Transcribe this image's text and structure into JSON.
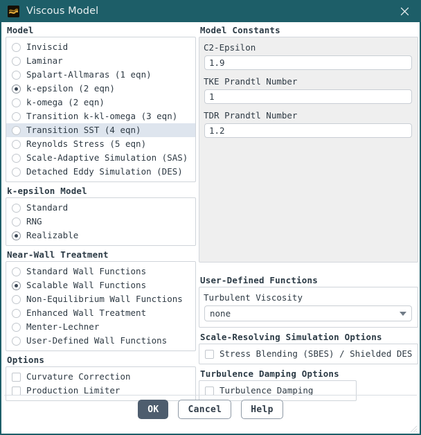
{
  "window": {
    "title": "Viscous Model",
    "icon": "fluent-wave-icon",
    "close_icon": "close-icon",
    "titlebar_color": "#1d5e68",
    "accent_color": "#4e5d6e",
    "highlight_color": "#dee5ee"
  },
  "model_group": {
    "title": "Model",
    "options": [
      {
        "label": "Inviscid",
        "selected": false,
        "highlighted": false
      },
      {
        "label": "Laminar",
        "selected": false,
        "highlighted": false
      },
      {
        "label": "Spalart-Allmaras (1 eqn)",
        "selected": false,
        "highlighted": false
      },
      {
        "label": "k-epsilon (2 eqn)",
        "selected": true,
        "highlighted": false
      },
      {
        "label": "k-omega (2 eqn)",
        "selected": false,
        "highlighted": false
      },
      {
        "label": "Transition k-kl-omega (3 eqn)",
        "selected": false,
        "highlighted": false
      },
      {
        "label": "Transition SST (4 eqn)",
        "selected": false,
        "highlighted": true
      },
      {
        "label": "Reynolds Stress (5 eqn)",
        "selected": false,
        "highlighted": false
      },
      {
        "label": "Scale-Adaptive Simulation (SAS)",
        "selected": false,
        "highlighted": false
      },
      {
        "label": "Detached Eddy Simulation (DES)",
        "selected": false,
        "highlighted": false
      }
    ]
  },
  "kepsilon_group": {
    "title": "k-epsilon Model",
    "options": [
      {
        "label": "Standard",
        "selected": false
      },
      {
        "label": "RNG",
        "selected": false
      },
      {
        "label": "Realizable",
        "selected": true
      }
    ]
  },
  "nearwall_group": {
    "title": "Near-Wall Treatment",
    "options": [
      {
        "label": "Standard Wall Functions",
        "selected": false
      },
      {
        "label": "Scalable Wall Functions",
        "selected": true
      },
      {
        "label": "Non-Equilibrium Wall Functions",
        "selected": false
      },
      {
        "label": "Enhanced Wall Treatment",
        "selected": false
      },
      {
        "label": "Menter-Lechner",
        "selected": false
      },
      {
        "label": "User-Defined Wall Functions",
        "selected": false
      }
    ]
  },
  "options_group": {
    "title": "Options",
    "options": [
      {
        "label": "Curvature Correction",
        "checked": false
      },
      {
        "label": "Production Limiter",
        "checked": false
      }
    ]
  },
  "constants_group": {
    "title": "Model Constants",
    "fields": [
      {
        "label": "C2-Epsilon",
        "value": "1.9"
      },
      {
        "label": "TKE Prandtl Number",
        "value": "1"
      },
      {
        "label": "TDR Prandtl Number",
        "value": "1.2"
      }
    ]
  },
  "udf_group": {
    "title": "User-Defined Functions",
    "field_label": "Turbulent Viscosity",
    "selected_value": "none",
    "caret_icon": "chevron-down-icon"
  },
  "srs_group": {
    "title": "Scale-Resolving Simulation Options",
    "options": [
      {
        "label": "Stress Blending (SBES) / Shielded DES",
        "checked": false
      }
    ]
  },
  "damping_group": {
    "title": "Turbulence Damping Options",
    "options": [
      {
        "label": "Turbulence Damping",
        "checked": false
      }
    ]
  },
  "footer": {
    "buttons": [
      {
        "label": "OK",
        "style": "primary"
      },
      {
        "label": "Cancel",
        "style": "ghost"
      },
      {
        "label": "Help",
        "style": "ghost"
      }
    ]
  }
}
